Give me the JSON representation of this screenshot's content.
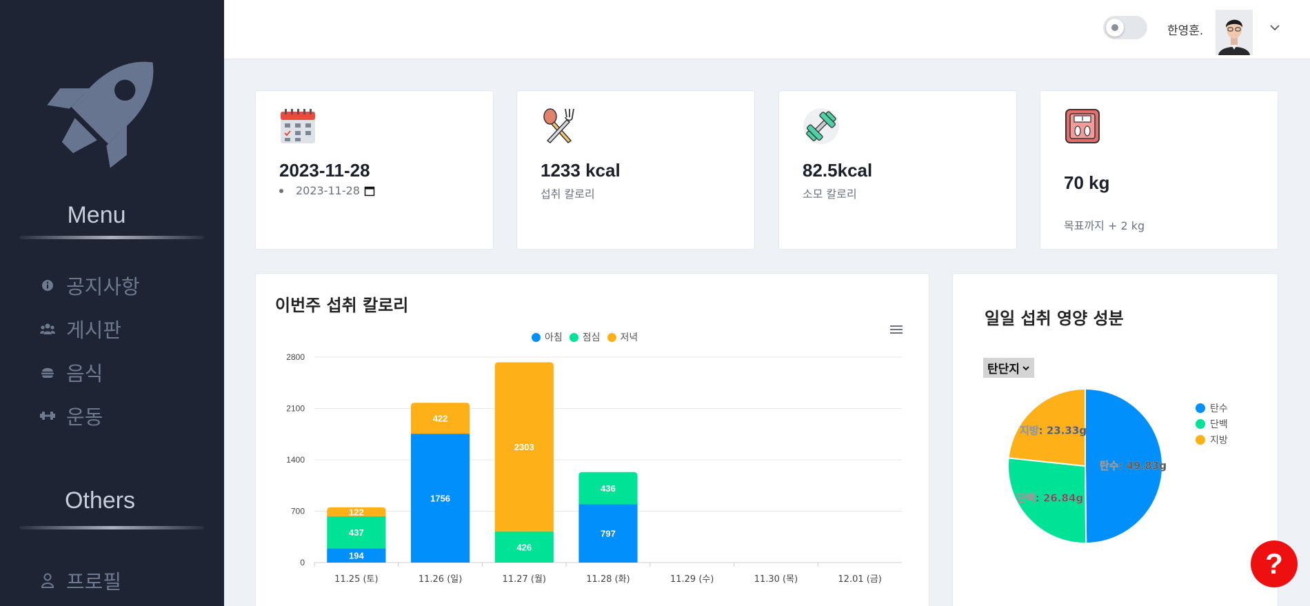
{
  "sidebar": {
    "menu_title": "Menu",
    "others_title": "Others",
    "items": [
      {
        "label": "공지사항",
        "icon": "info-icon"
      },
      {
        "label": "게시판",
        "icon": "users-icon"
      },
      {
        "label": "음식",
        "icon": "burger-icon"
      },
      {
        "label": "운동",
        "icon": "dumbbell-icon"
      }
    ],
    "others": [
      {
        "label": "프로필",
        "icon": "user-icon"
      }
    ]
  },
  "header": {
    "user_name": "한영훈."
  },
  "stats": {
    "date": {
      "value": "2023-11-28",
      "input_value": "2023-11-28",
      "icon": "calendar-icon"
    },
    "intake": {
      "value": "1233  kcal",
      "label": "섭취 칼로리",
      "icon": "fork-spoon-icon"
    },
    "burned": {
      "value": "82.5kcal",
      "label": "소모 칼로리",
      "icon": "dumbbell-icon"
    },
    "weight": {
      "value": "70  kg",
      "label": "목표까지 + 2 kg",
      "icon": "scale-icon"
    }
  },
  "weekly": {
    "title": "이번주 섭취 칼로리"
  },
  "nutrition": {
    "title": "일일 섭취 영양 성분",
    "select_value": "탄단지"
  },
  "chart_data": [
    {
      "type": "bar",
      "stacked": true,
      "title": "이번주 섭취 칼로리",
      "categories": [
        "11.25 (토)",
        "11.26 (일)",
        "11.27 (월)",
        "11.28 (화)",
        "11.29 (수)",
        "11.30 (목)",
        "12.01 (금)"
      ],
      "series": [
        {
          "name": "아침",
          "color": "#008ffb",
          "values": [
            194,
            1756,
            0,
            797,
            0,
            0,
            0
          ]
        },
        {
          "name": "점심",
          "color": "#00e396",
          "values": [
            437,
            0,
            426,
            436,
            0,
            0,
            0
          ]
        },
        {
          "name": "저녁",
          "color": "#feb019",
          "values": [
            122,
            422,
            2303,
            0,
            0,
            0,
            0
          ]
        }
      ],
      "yticks": [
        0,
        700,
        1400,
        2100,
        2800
      ],
      "ylim": [
        0,
        2800
      ],
      "legend": "top-center",
      "grid": true
    },
    {
      "type": "pie",
      "title": "일일 섭취 영양 성분",
      "slices": [
        {
          "name": "탄수",
          "value": 49.83,
          "label": "탄수: 49.83g",
          "color": "#008ffb"
        },
        {
          "name": "단백",
          "value": 26.84,
          "label": "단백: 26.84g",
          "color": "#00e396"
        },
        {
          "name": "지방",
          "value": 23.33,
          "label": "지방: 23.33g",
          "color": "#feb019"
        }
      ],
      "legend": "right"
    }
  ],
  "help_label": "?"
}
